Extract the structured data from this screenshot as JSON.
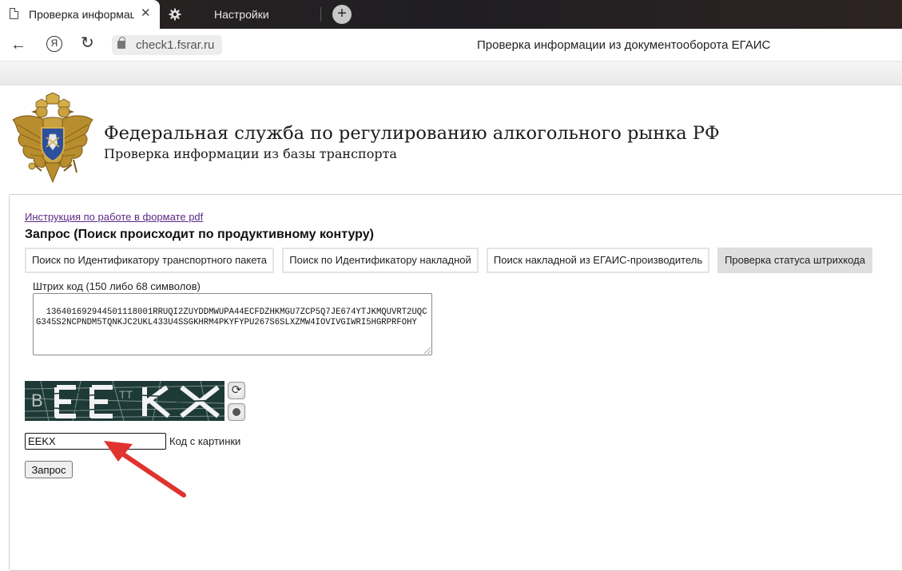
{
  "browser": {
    "active_tab_title": "Проверка информаци",
    "tab_close_glyph": "✕",
    "second_tab_title": "Настройки",
    "new_tab_glyph": "+",
    "back_glyph": "←",
    "yandex_glyph": "Я",
    "reload_glyph": "↻",
    "url": "check1.fsrar.ru",
    "page_title": "Проверка информации из документооборота ЕГАИС"
  },
  "header": {
    "title": "Федеральная служба по регулированию алкогольного рынка РФ",
    "subtitle": "Проверка информации из базы транспорта"
  },
  "form": {
    "pdf_link": "Инструкция по работе в формате pdf",
    "query_heading": "Запрос (Поиск происходит по продуктивному контуру)",
    "tabs": [
      {
        "label": "Поиск по Идентификатору транспортного пакета",
        "active": false
      },
      {
        "label": "Поиск по Идентификатору накладной",
        "active": false
      },
      {
        "label": "Поиск накладной из ЕГАИС-производитель",
        "active": false
      },
      {
        "label": "Проверка статуса штрихкода",
        "active": true
      }
    ],
    "barcode_label": "Штрих код (150 либо 68 символов)",
    "barcode_value": "136401692944501118001RRUQI2ZUYDDMWUPA44ECFDZHKMGU7ZCP5Q7JE674YTJKMQUVRT2UQCG345S2NCPNDM5TQNKJC2UKL433U4SSGKHRM4PKYFYPU267S6SLXZMW4IOVIVGIWRI5HGRPRFOHY",
    "captcha_text": "EEKX",
    "refresh_glyph": "⟳",
    "code_value": "EEKX",
    "code_label": "Код с картинки",
    "submit_label": "Запрос"
  },
  "colors": {
    "link": "#5b2a86",
    "annotation_arrow": "#e0332e",
    "active_tab_bg": "#dedede",
    "captcha_bg": "#1e3a36"
  }
}
